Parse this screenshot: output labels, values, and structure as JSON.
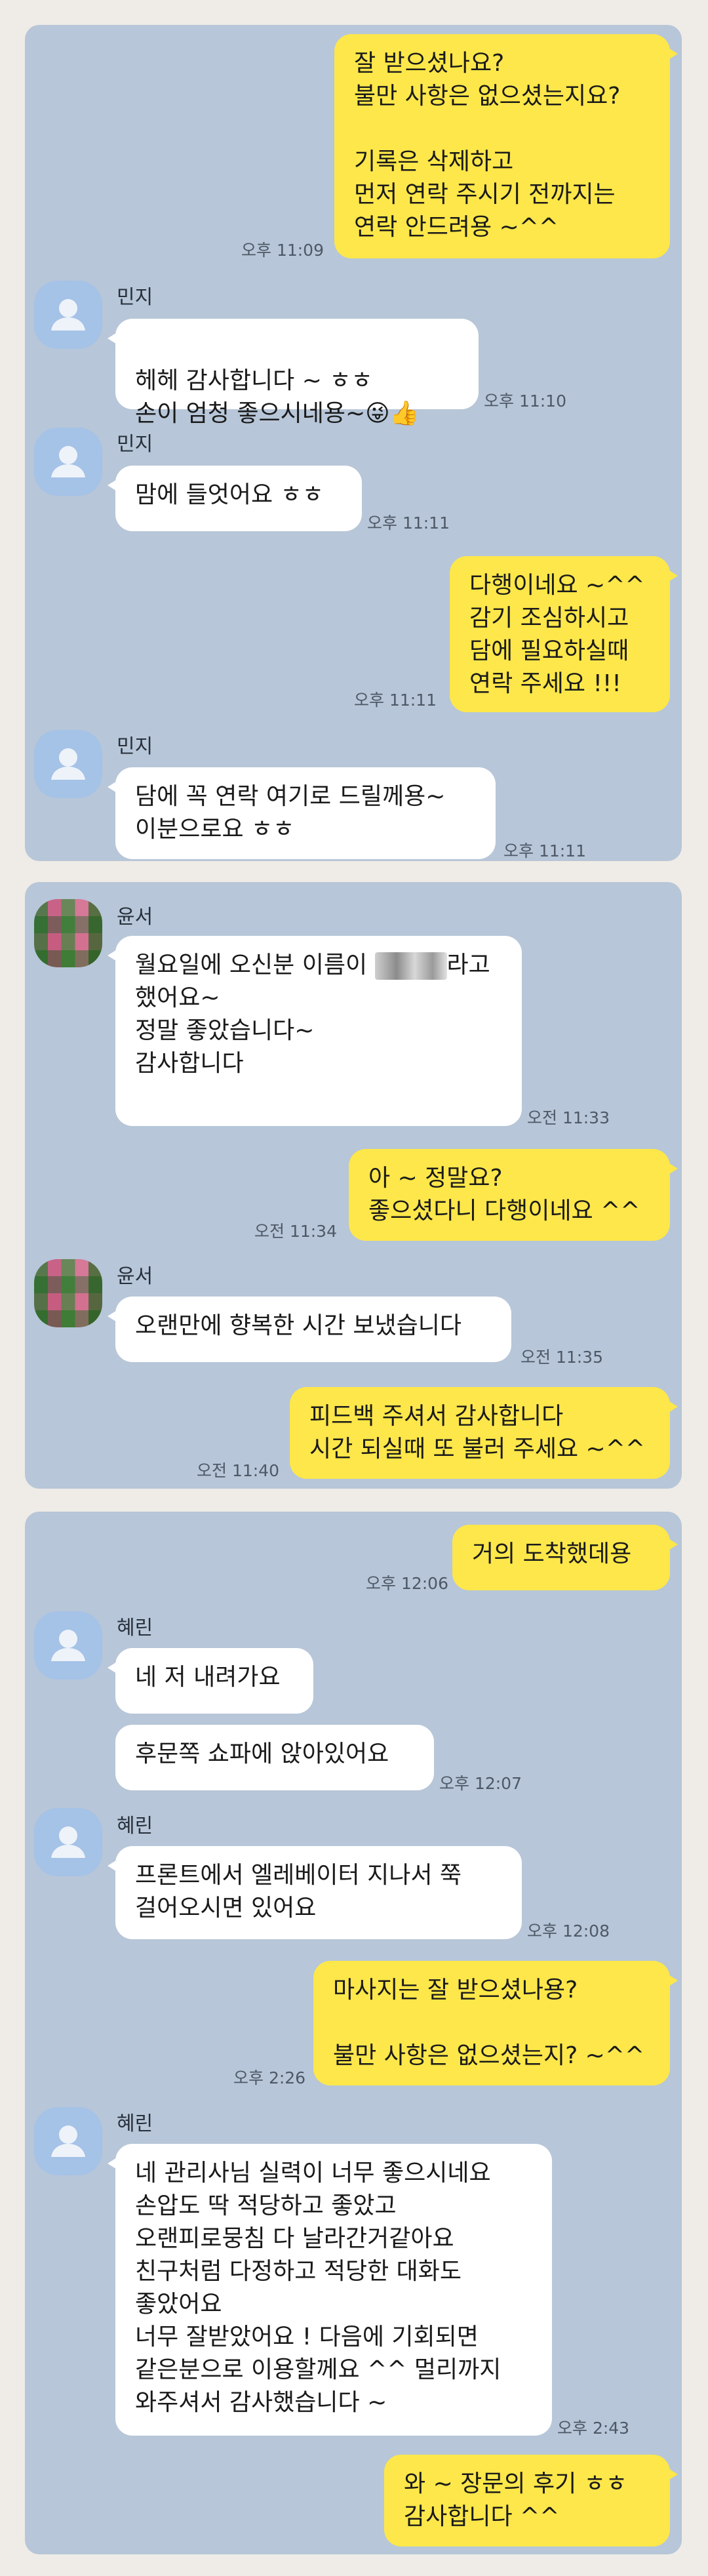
{
  "panel1": {
    "m1": {
      "text": "잘 받으셨나요?\n불만 사항은 없으셨는지요?\n\n기록은 삭제하고\n먼저 연락 주시기 전까지는\n연락 안드려용 ~^^",
      "time": "오후 11:09"
    },
    "sender1": "민지",
    "m2": {
      "text": "헤헤 감사합니다 ~ ㅎㅎ\n손이 엄청 좋으시네용~",
      "emoji": "😜👍",
      "time": "오후 11:10"
    },
    "sender2": "민지",
    "m3": {
      "text": "맘에 들엇어요 ㅎㅎ",
      "time": "오후 11:11"
    },
    "m4": {
      "text": "다행이네요 ~^^\n감기 조심하시고\n담에 필요하실때\n연락 주세요 !!!",
      "time": "오후 11:11"
    },
    "sender3": "민지",
    "m5": {
      "text": "담에 꼭 연락 여기로 드릴께용~\n이분으로요 ㅎㅎ",
      "time": "오후 11:11"
    }
  },
  "panel2": {
    "sender1": "윤서",
    "m1": {
      "text_a": "월요일에 오신분 이름이 ",
      "text_b": "라고",
      "text_c": "했어요~\n정말 좋았습니다~\n감사합니다",
      "time": "오전 11:33"
    },
    "m2": {
      "text": "아 ~ 정말요?\n좋으셨다니 다행이네요 ^^",
      "time": "오전 11:34"
    },
    "sender2": "윤서",
    "m3": {
      "text": "오랜만에 향복한 시간 보냈습니다",
      "time": "오전 11:35"
    },
    "m4": {
      "text": "피드백 주셔서 감사합니다\n시간 되실때 또 불러 주세요 ~^^",
      "time": "오전 11:40"
    }
  },
  "panel3": {
    "m1": {
      "text": "거의 도착했데용",
      "time": "오후 12:06"
    },
    "sender1": "혜린",
    "m2": {
      "text": "네 저 내려가요"
    },
    "m3": {
      "text": "후문쪽 쇼파에 앉아있어요",
      "time": "오후 12:07"
    },
    "sender2": "혜린",
    "m4": {
      "text": "프론트에서 엘레베이터 지나서 쭉\n걸어오시면 있어요",
      "time": "오후 12:08"
    },
    "m5": {
      "text": "마사지는 잘 받으셨나용?\n\n불만 사항은 없으셨는지? ~^^",
      "time": "오후 2:26"
    },
    "sender3": "혜린",
    "m6": {
      "text": "네 관리사님 실력이 너무 좋으시네요\n손압도 딱 적당하고 좋았고\n오랜피로뭉침 다 날라간거같아요\n친구처럼 다정하고 적당한 대화도\n좋았어요\n너무 잘받았어요 ! 다음에 기회되면\n같은분으로 이용할께요 ^^ 멀리까지\n와주셔서 감사했습니다 ~",
      "time": "오후 2:43"
    },
    "m7": {
      "text": "와 ~ 장문의 후기 ㅎㅎ\n감사합니다 ^^"
    }
  },
  "icons": {
    "default_avatar": "person-silhouette-icon",
    "pixelated_avatar": "pixelated-photo-avatar"
  },
  "colors": {
    "panel": "#b7c6d8",
    "incoming": "#ffffff",
    "outgoing": "#fde74a",
    "page": "#efebe6"
  }
}
